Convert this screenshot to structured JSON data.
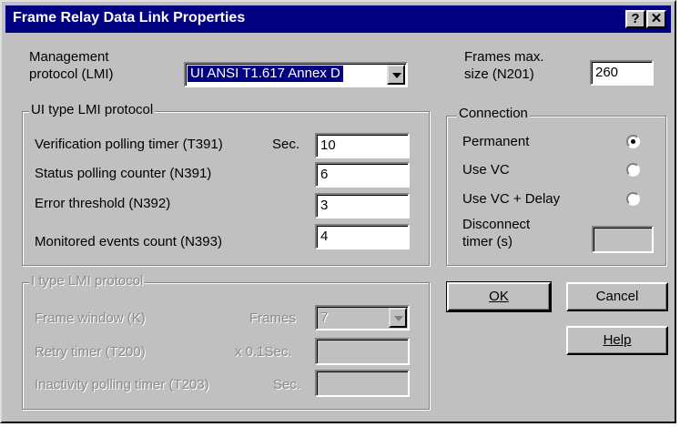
{
  "window": {
    "title": "Frame Relay Data Link Properties",
    "help_label": "?",
    "close_label": "✕"
  },
  "management": {
    "label_line1": "Management",
    "label_line2": "protocol (LMI)",
    "selected": "UI ANSI T1.617 Annex D"
  },
  "frames_max": {
    "label_line1": "Frames max.",
    "label_line2": "size (N201)",
    "value": "260"
  },
  "ui_group": {
    "title": "UI type LMI protocol",
    "rows": [
      {
        "label": "Verification polling timer (T391)",
        "unit": "Sec.",
        "value": "10"
      },
      {
        "label": "Status polling counter (N391)",
        "unit": "",
        "value": "6"
      },
      {
        "label": "Error threshold (N392)",
        "unit": "",
        "value": "3"
      },
      {
        "label": "Monitored events count (N393)",
        "unit": "",
        "value": "4"
      }
    ]
  },
  "connection": {
    "title": "Connection",
    "options": [
      {
        "label": "Permanent",
        "selected": true
      },
      {
        "label": "Use VC",
        "selected": false
      },
      {
        "label": "Use VC + Delay",
        "selected": false
      }
    ],
    "disconnect_line1": "Disconnect",
    "disconnect_line2": "timer (s)",
    "disconnect_value": ""
  },
  "i_group": {
    "title": "I type LMI protocol",
    "frame_window": {
      "label": "Frame window (K)",
      "unit": "Frames",
      "value": "7"
    },
    "retry": {
      "label": "Retry timer (T200)",
      "unit": "x 0.1Sec.",
      "value": ""
    },
    "inactivity": {
      "label": "Inactivity polling timer (T203)",
      "unit": "Sec.",
      "value": ""
    }
  },
  "buttons": {
    "ok": "OK",
    "cancel": "Cancel",
    "help": "Help"
  }
}
